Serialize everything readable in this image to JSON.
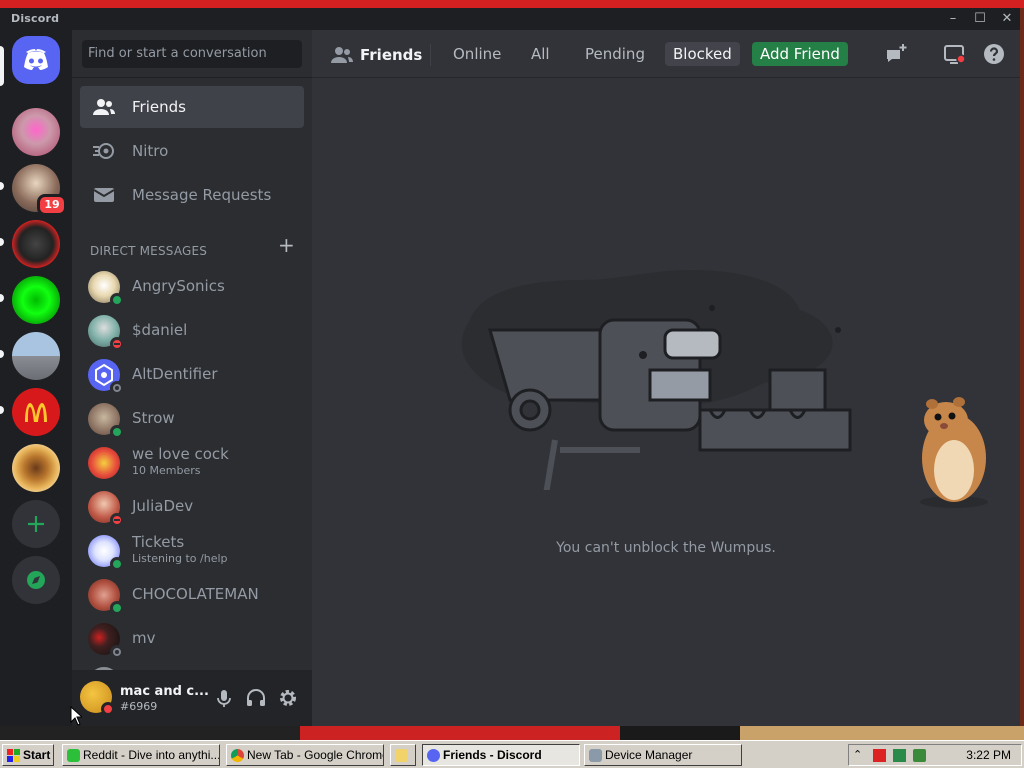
{
  "window": {
    "app_title": "Discord"
  },
  "rail": {
    "mention_badge": "19"
  },
  "sidebar": {
    "search_label": "Find or start a conversation",
    "nav": [
      {
        "label": "Friends"
      },
      {
        "label": "Nitro"
      },
      {
        "label": "Message Requests"
      }
    ],
    "dm_header": "DIRECT MESSAGES",
    "dm_add": "+",
    "dms": [
      {
        "name": "AngrySonics",
        "sub": "",
        "status": "online"
      },
      {
        "name": "$daniel",
        "sub": "",
        "status": "dnd"
      },
      {
        "name": "AltDentifier",
        "sub": "",
        "status": "offline"
      },
      {
        "name": "Strow",
        "sub": "",
        "status": "online"
      },
      {
        "name": "we love cock",
        "sub": "10 Members",
        "status": ""
      },
      {
        "name": "JuliaDev",
        "sub": "",
        "status": "dnd"
      },
      {
        "name": "Tickets",
        "sub": "Listening to /help",
        "status": "online"
      },
      {
        "name": "CHOCOLATEMAN",
        "sub": "",
        "status": "online"
      },
      {
        "name": "mv",
        "sub": "",
        "status": "offline"
      }
    ]
  },
  "user": {
    "name": "mac and c...",
    "tag": "#6969",
    "status": "dnd"
  },
  "topbar": {
    "title": "Friends",
    "tabs": [
      "Online",
      "All",
      "Pending",
      "Blocked"
    ],
    "active_tab": "Blocked",
    "add_friend": "Add Friend"
  },
  "main": {
    "empty_message": "You can't unblock the Wumpus."
  },
  "taskbar": {
    "start": "Start",
    "tasks": [
      {
        "label": "Reddit - Dive into anythi..."
      },
      {
        "label": "New Tab - Google Chrome"
      },
      {
        "label": ""
      },
      {
        "label": "Friends - Discord"
      },
      {
        "label": "Device Manager"
      }
    ],
    "clock": "3:22 PM"
  },
  "colors": {
    "accent": "#5865f2",
    "add_friend_green": "#248046",
    "online": "#23a55a",
    "dnd": "#f23f43",
    "offline": "#80848e"
  }
}
